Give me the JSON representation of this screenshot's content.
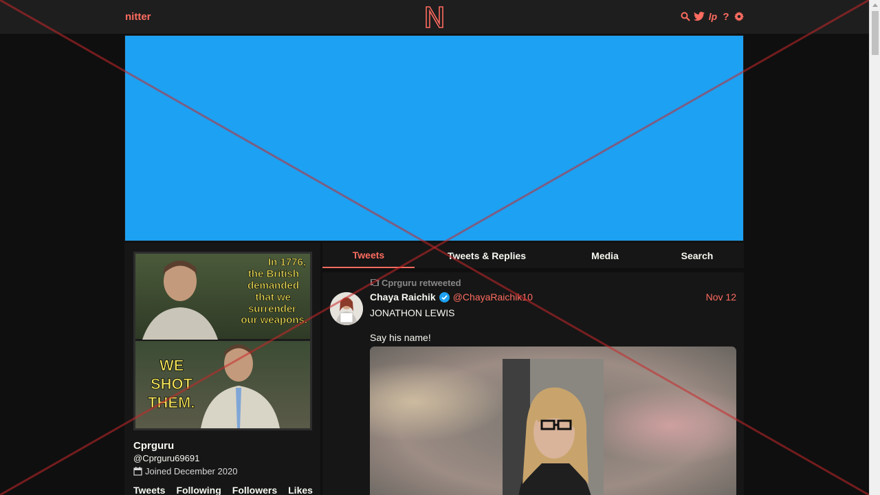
{
  "nav": {
    "logo_text": "nitter",
    "center_logo_letter": "N",
    "icons": [
      "search-icon",
      "twitter-bird-icon",
      "lp-icon",
      "help-icon",
      "gear-icon"
    ],
    "lp_label": "lp",
    "help_label": "?"
  },
  "colors": {
    "accent": "#ff6c60",
    "banner": "#1da1f2",
    "background": "#0f0f0f",
    "panel": "#161616",
    "nav": "#1e1e1e"
  },
  "avatar_image": {
    "top_caption": [
      "In 1776,",
      "the British",
      "demanded",
      "that we",
      "surrender",
      "our weapons."
    ],
    "bottom_caption": [
      "WE",
      "SHOT",
      "THEM."
    ]
  },
  "profile": {
    "name": "Cprguru",
    "handle": "@Cprguru69691",
    "joined": "Joined December 2020",
    "stats": [
      "Tweets",
      "Following",
      "Followers",
      "Likes"
    ]
  },
  "tabs": [
    {
      "label": "Tweets",
      "active": true
    },
    {
      "label": "Tweets & Replies",
      "active": false
    },
    {
      "label": "Media",
      "active": false
    },
    {
      "label": "Search",
      "active": false
    }
  ],
  "tweet": {
    "retweet_header": "Cprguru retweeted",
    "fullname": "Chaya Raichik",
    "username": "@ChayaRaichik10",
    "date": "Nov 12",
    "text_line1": "JONATHON LEWIS",
    "text_line2": "Say his name!"
  }
}
